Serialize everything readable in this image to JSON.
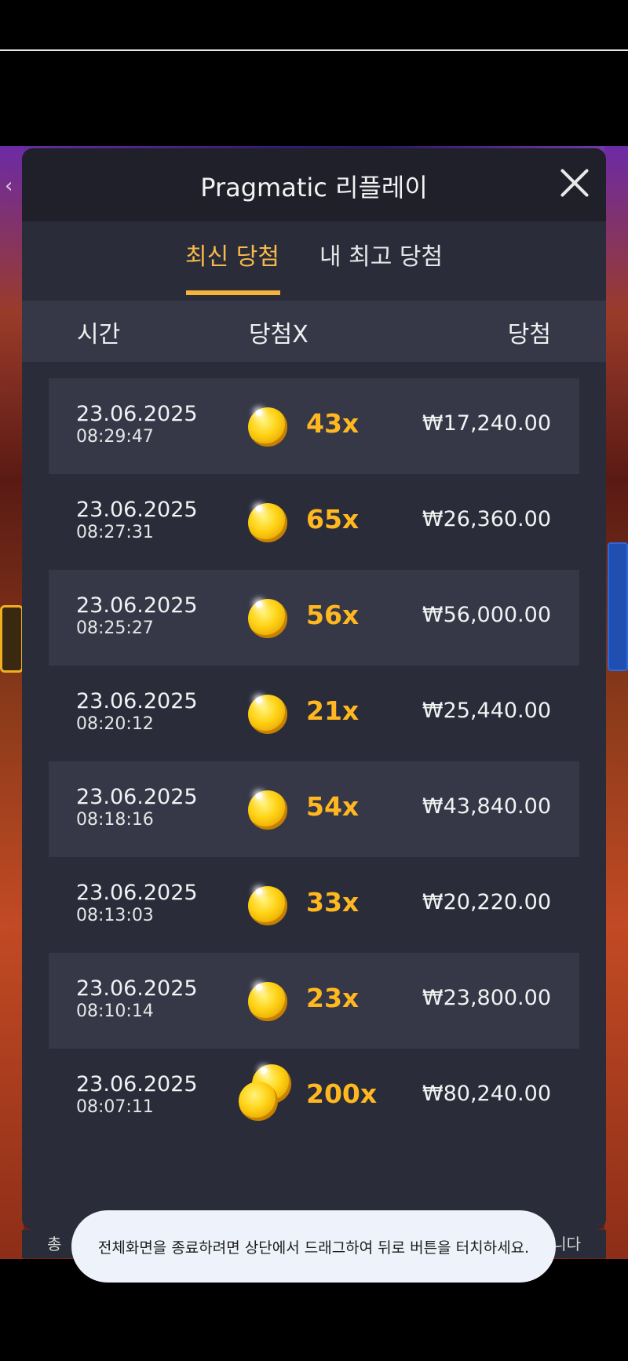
{
  "modal": {
    "title": "Pragmatic 리플레이"
  },
  "tabs": [
    {
      "label": "최신 당첨",
      "active": true
    },
    {
      "label": "내 최고 당첨",
      "active": false
    }
  ],
  "table": {
    "headers": {
      "time": "시간",
      "multiplier": "당첨X",
      "win": "당첨"
    },
    "rows": [
      {
        "date": "23.06.2025",
        "time": "08:29:47",
        "multiplier": "43x",
        "amount": "₩17,240.00",
        "coins": 1
      },
      {
        "date": "23.06.2025",
        "time": "08:27:31",
        "multiplier": "65x",
        "amount": "₩26,360.00",
        "coins": 1
      },
      {
        "date": "23.06.2025",
        "time": "08:25:27",
        "multiplier": "56x",
        "amount": "₩56,000.00",
        "coins": 1
      },
      {
        "date": "23.06.2025",
        "time": "08:20:12",
        "multiplier": "21x",
        "amount": "₩25,440.00",
        "coins": 1
      },
      {
        "date": "23.06.2025",
        "time": "08:18:16",
        "multiplier": "54x",
        "amount": "₩43,840.00",
        "coins": 1
      },
      {
        "date": "23.06.2025",
        "time": "08:13:03",
        "multiplier": "33x",
        "amount": "₩20,220.00",
        "coins": 1
      },
      {
        "date": "23.06.2025",
        "time": "08:10:14",
        "multiplier": "23x",
        "amount": "₩23,800.00",
        "coins": 1
      },
      {
        "date": "23.06.2025",
        "time": "08:07:11",
        "multiplier": "200x",
        "amount": "₩80,240.00",
        "coins": 2
      }
    ]
  },
  "background_strip": {
    "left_text": "총 ",
    "right_text": "니다"
  },
  "toast": {
    "message": "전체화면을 종료하려면 상단에서 드래그하여 뒤로 버튼을 터치하세요."
  },
  "colors": {
    "accent": "#f6b23a",
    "multiplier": "#ffb81f",
    "modal_bg": "#2a2c3a"
  },
  "icons": {
    "close": "close-icon",
    "back": "chevron-left-icon",
    "coin": "coin-icon"
  }
}
